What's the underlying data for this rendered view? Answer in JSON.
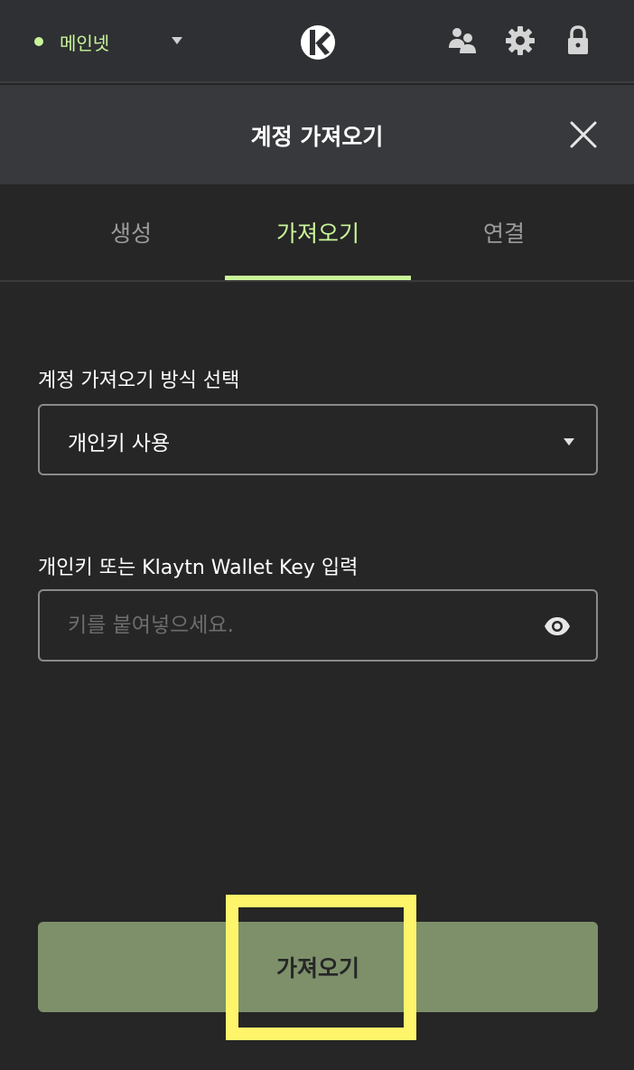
{
  "topbar": {
    "network_label": "메인넷",
    "icons": [
      "network-dot-icon",
      "chevron-down-icon",
      "klaytn-logo-icon",
      "people-icon",
      "gear-icon",
      "lock-icon"
    ],
    "accent_color": "#c9f59a"
  },
  "header": {
    "title": "계정 가져오기"
  },
  "tabs": [
    {
      "label": "생성",
      "active": false
    },
    {
      "label": "가져오기",
      "active": true
    },
    {
      "label": "연결",
      "active": false
    }
  ],
  "form": {
    "method_label": "계정 가져오기 방식 선택",
    "method_value": "개인키 사용",
    "key_label": "개인키 또는 Klaytn Wallet Key 입력",
    "key_placeholder": "키를 붙여넣으세요.",
    "key_value": ""
  },
  "import_button": {
    "label": "가져오기",
    "color": "#7d906a"
  },
  "highlight_color": "#fff56b"
}
